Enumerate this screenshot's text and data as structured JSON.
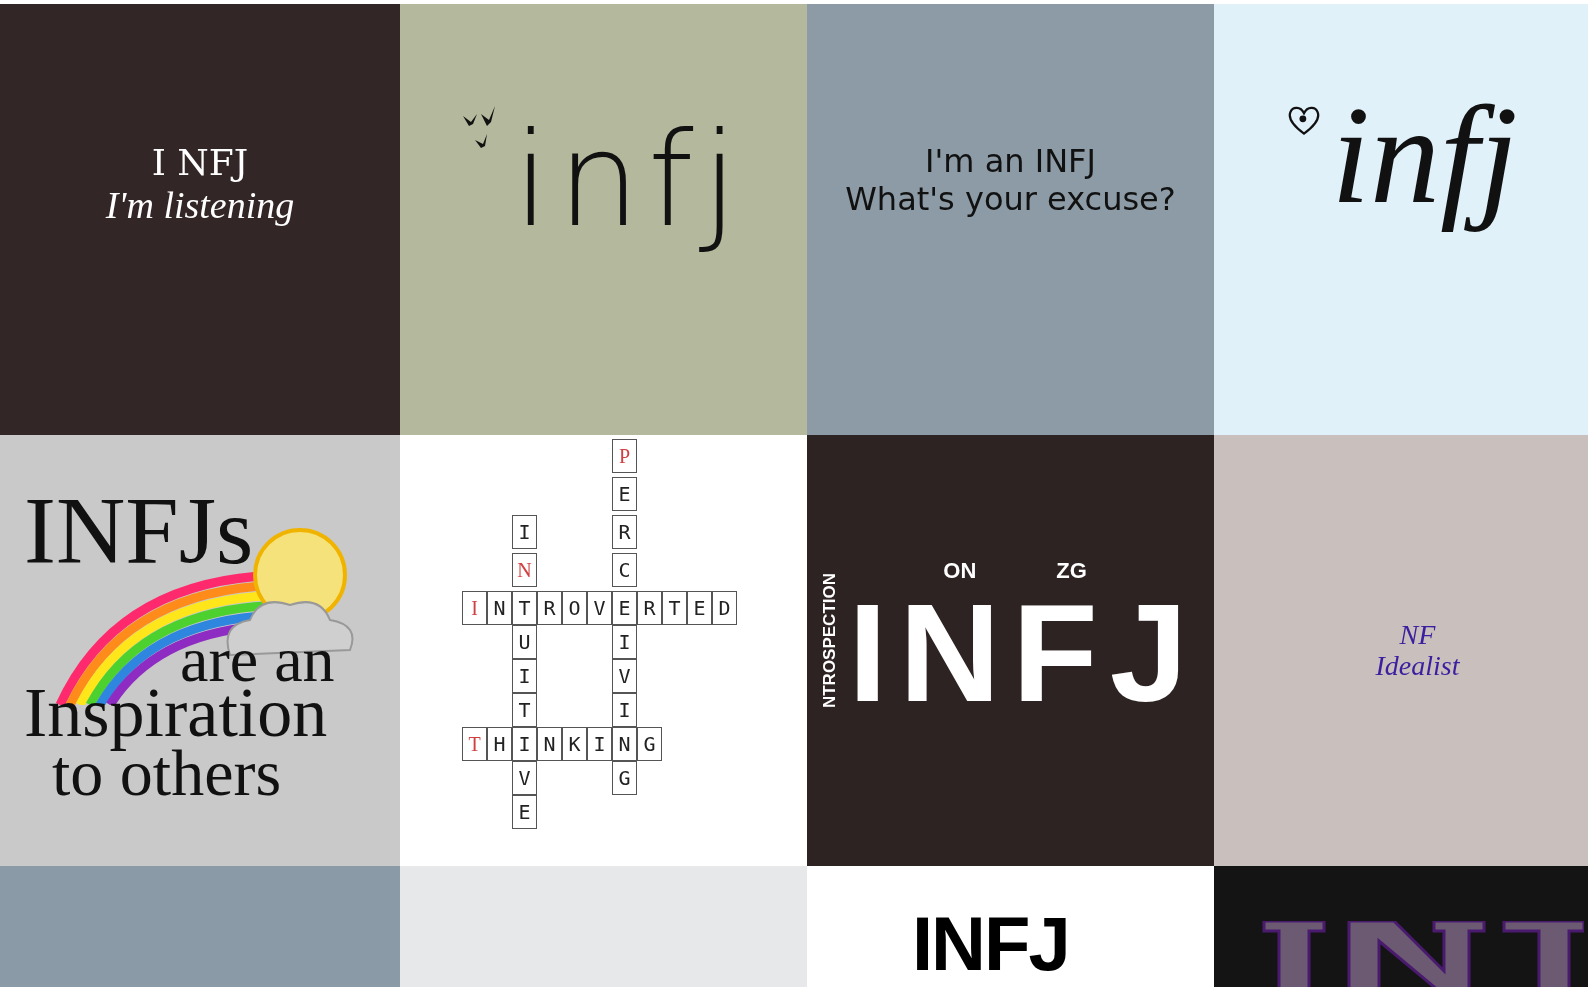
{
  "tiles": [
    {
      "kind": "listening",
      "color": "#332626",
      "lines": [
        "I NFJ",
        "I'm listening"
      ]
    },
    {
      "kind": "birds",
      "color": "#b4b89c",
      "lines": [
        "infj"
      ]
    },
    {
      "kind": "excuse",
      "color": "#8c9ba6",
      "lines": [
        "I'm an INFJ",
        "What's your excuse?"
      ]
    },
    {
      "kind": "script",
      "color": "#e1f1f9",
      "lines": [
        "infj"
      ]
    },
    {
      "kind": "rainbow",
      "color": "#c9c9c9",
      "lines": [
        "INFJs",
        "are an",
        "Inspiration",
        "to others"
      ]
    },
    {
      "kind": "crossword",
      "color": "#ffffff",
      "rows": [
        [
          {
            "letter": "P",
            "highlight": true
          }
        ],
        [
          {
            "letter": "E",
            "highlight": false
          }
        ],
        [
          {
            "letter": "I",
            "highlight": false
          },
          {
            "letter": "R",
            "highlight": false
          }
        ],
        [
          {
            "letter": "N",
            "highlight": true
          },
          {
            "letter": "C",
            "highlight": false
          }
        ],
        [
          {
            "letter": "I",
            "highlight": true
          },
          {
            "letter": "N",
            "highlight": false
          },
          {
            "letter": "T",
            "highlight": false
          },
          {
            "letter": "R",
            "highlight": false
          },
          {
            "letter": "O",
            "highlight": false
          },
          {
            "letter": "V",
            "highlight": false
          },
          {
            "letter": "E",
            "highlight": false
          },
          {
            "letter": "R",
            "highlight": false
          },
          {
            "letter": "T",
            "highlight": false
          },
          {
            "letter": "E",
            "highlight": false
          },
          {
            "letter": "D",
            "highlight": false
          }
        ],
        [
          {
            "letter": "U",
            "highlight": false
          },
          {
            "letter": "I",
            "highlight": false
          }
        ],
        [
          {
            "letter": "I",
            "highlight": false
          },
          {
            "letter": "V",
            "highlight": false
          }
        ],
        [
          {
            "letter": "T",
            "highlight": false
          },
          {
            "letter": "I",
            "highlight": false
          }
        ],
        [
          {
            "letter": "T",
            "highlight": true
          },
          {
            "letter": "H",
            "highlight": false
          },
          {
            "letter": "I",
            "highlight": false
          },
          {
            "letter": "N",
            "highlight": false
          },
          {
            "letter": "K",
            "highlight": false
          },
          {
            "letter": "I",
            "highlight": false
          },
          {
            "letter": "N",
            "highlight": false
          },
          {
            "letter": "G",
            "highlight": false
          }
        ],
        [
          {
            "letter": "V",
            "highlight": false
          },
          {
            "letter": "G",
            "highlight": false
          }
        ],
        [
          {
            "letter": "E",
            "highlight": false
          }
        ]
      ]
    },
    {
      "kind": "collage",
      "color": "#2e2323",
      "lines": [
        "NTROSPECTION",
        "ON",
        "ZG",
        "INFJ"
      ]
    },
    {
      "kind": "idealist",
      "color": "#c9c0bd",
      "lines": [
        "NF",
        "Idealist"
      ]
    },
    {
      "kind": "plain",
      "color": "#8a9aa6"
    },
    {
      "kind": "plain",
      "color": "#e6e8ea"
    },
    {
      "kind": "bold",
      "color": "#ffffff",
      "lines": [
        "INFJ"
      ]
    },
    {
      "kind": "grunge",
      "color": "#141414"
    }
  ]
}
